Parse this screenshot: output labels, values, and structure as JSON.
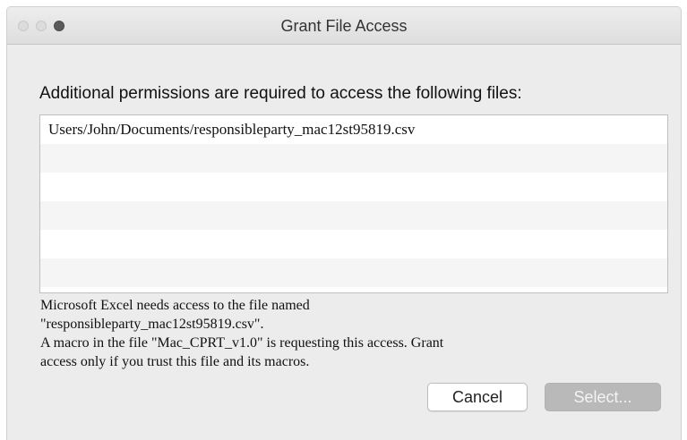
{
  "window": {
    "title": "Grant File Access"
  },
  "dialog": {
    "heading": "Additional permissions are required to access the following files:",
    "files": [
      "Users/John/Documents/responsibleparty_mac12st95819.csv"
    ],
    "message_lines": [
      "Microsoft Excel needs access to the file named",
      "\"responsibleparty_mac12st95819.csv\".",
      "A macro in the file \"Mac_CPRT_v1.0\" is requesting this access. Grant",
      "access only if you trust this file and its macros."
    ],
    "cancel_label": "Cancel",
    "select_label": "Select..."
  },
  "colors": {
    "window_bg": "#ececec",
    "primary_button_disabled": "#b9b9b9"
  }
}
